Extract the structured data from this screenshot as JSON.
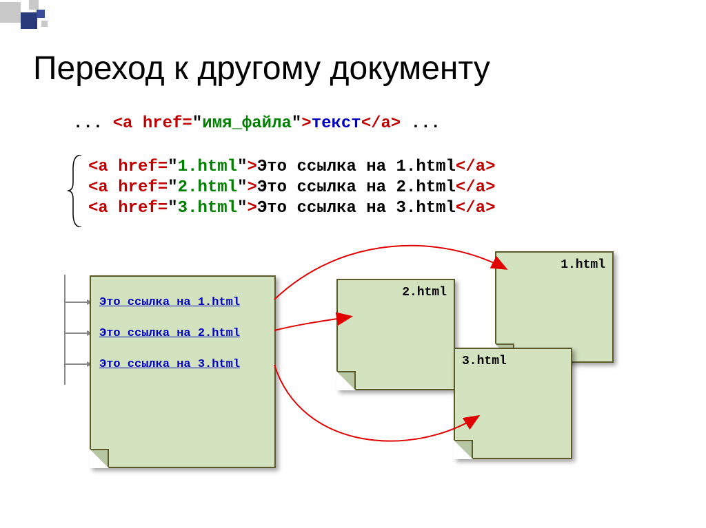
{
  "title": "Переход к другому документу",
  "code_template": {
    "prefix": "... ",
    "open1": "<a",
    "attr": " href=",
    "quote1": "\"",
    "val": "имя_файла",
    "quote2": "\"",
    "close_open": ">",
    "text": "текст",
    "close": "</a>",
    "suffix": " ..."
  },
  "code_lines": [
    {
      "open": "<a",
      "attr": " href=",
      "q1": "\"",
      "val": "1.html",
      "q2": "\"",
      "gt": ">",
      "text": "Это ссылка на 1.html",
      "close": "</a>"
    },
    {
      "open": "<a",
      "attr": " href=",
      "q1": "\"",
      "val": "2.html",
      "q2": "\"",
      "gt": ">",
      "text": "Это ссылка на 2.html",
      "close": "</a>"
    },
    {
      "open": "<a",
      "attr": " href=",
      "q1": "\"",
      "val": "3.html",
      "q2": "\"",
      "gt": ">",
      "text": "Это ссылка на 3.html",
      "close": "</a>"
    }
  ],
  "source_doc": {
    "links": [
      "Это ссылка на 1.html",
      "Это ссылка на 2.html",
      "Это ссылка на 3.html"
    ]
  },
  "target_docs": {
    "doc1": "1.html",
    "doc2": "2.html",
    "doc3": "3.html"
  }
}
